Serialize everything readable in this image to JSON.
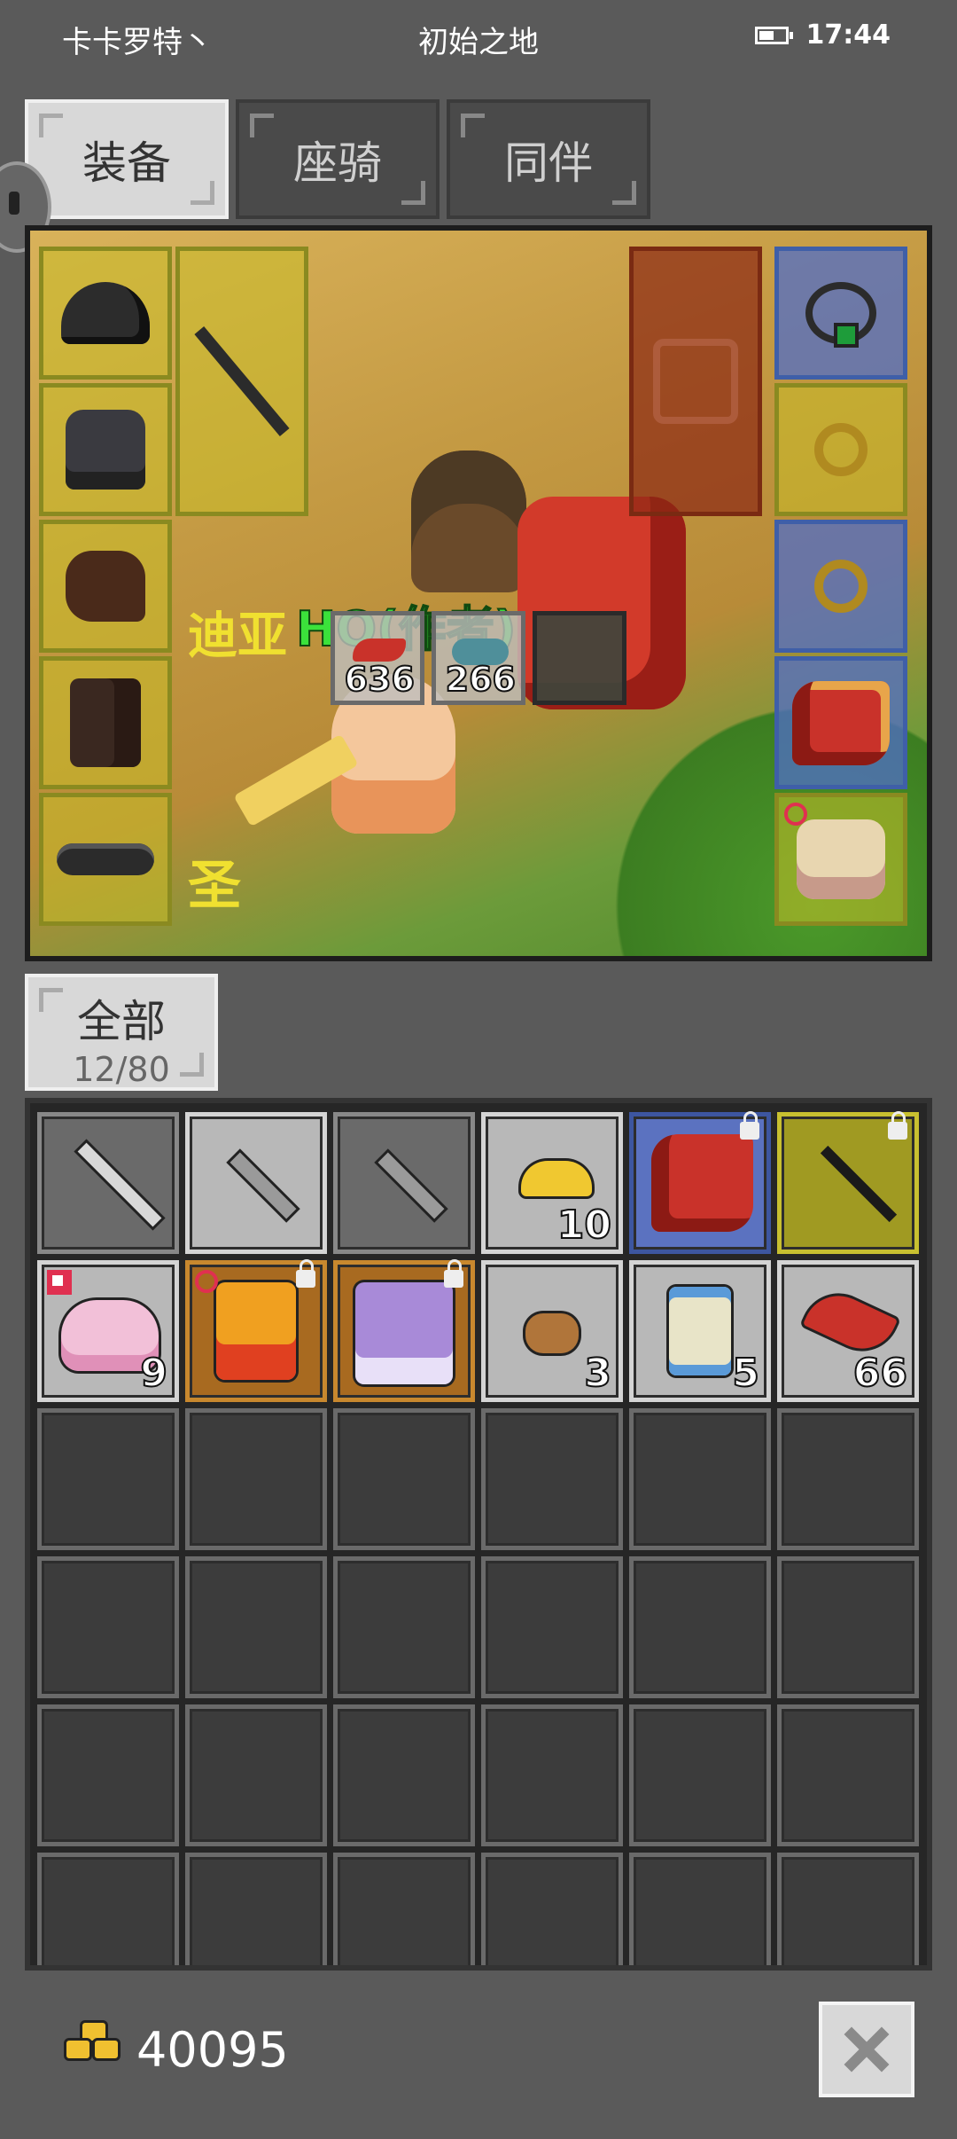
{
  "status_bar": {
    "player_name": "卡卡罗特丶",
    "location": "初始之地",
    "time": "17:44",
    "battery_level": 0.6
  },
  "tabs": [
    {
      "label": "装备",
      "active": true
    },
    {
      "label": "座骑",
      "active": false
    },
    {
      "label": "同伴",
      "active": false
    }
  ],
  "equipment": {
    "character_name": "HQ(作者)",
    "side_text_1": "迪亚",
    "side_text_2": "圣",
    "left_slots": [
      "helmet",
      "armor",
      "gloves",
      "boots",
      "belt"
    ],
    "weapon_slot": "spear",
    "offhand_slot": "empty-shield",
    "right_slots": [
      "necklace",
      "ring",
      "ring",
      "dragon-mount",
      "cat-pet"
    ],
    "quick_slots": [
      {
        "icon": "feather-icon",
        "count": "636"
      },
      {
        "icon": "fish-icon",
        "count": "266"
      },
      {
        "icon": "empty-slot-icon",
        "count": ""
      }
    ]
  },
  "filter": {
    "label": "全部",
    "capacity": "12/80"
  },
  "inventory": {
    "rows_visible": 6,
    "items": [
      {
        "icon": "sword-icon",
        "color": "darkgray",
        "count": ""
      },
      {
        "icon": "knife-icon",
        "color": "gray",
        "count": ""
      },
      {
        "icon": "knife-icon",
        "color": "darkgray",
        "count": ""
      },
      {
        "icon": "gold-ingot-icon",
        "color": "gray",
        "count": "10"
      },
      {
        "icon": "dragon-icon",
        "color": "blue",
        "count": "",
        "locked": true
      },
      {
        "icon": "trident-icon",
        "color": "yellow",
        "count": "",
        "locked": true
      },
      {
        "icon": "cake-icon",
        "color": "gray",
        "count": "9",
        "marked": true
      },
      {
        "icon": "treasure-box-icon",
        "color": "orange",
        "count": "",
        "locked": true,
        "gender": true
      },
      {
        "icon": "card-icon",
        "color": "orange",
        "count": "",
        "locked": true
      },
      {
        "icon": "ore-icon",
        "color": "gray",
        "count": "3"
      },
      {
        "icon": "scroll-icon",
        "color": "gray",
        "count": "5"
      },
      {
        "icon": "feather-icon",
        "color": "gray",
        "count": "66"
      }
    ]
  },
  "footer": {
    "gold": "40095"
  }
}
